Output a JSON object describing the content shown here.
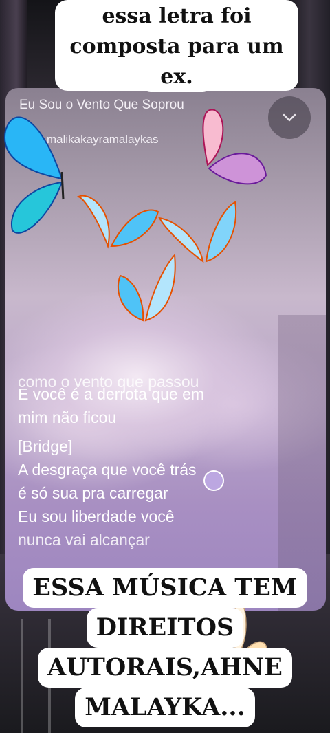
{
  "caption_top": {
    "line1": "essa letra foi",
    "line2": "composta para um",
    "line3": "ex."
  },
  "player": {
    "song_title": "Eu Sou o Vento Que Soprou",
    "artist": "malikakayramalaykas",
    "collapse_icon": "chevron-down-icon",
    "lyrics": {
      "cut_line": "como o vento que passou",
      "lines": [
        "E você é a derrota que em",
        "mim não ficou",
        "[Bridge]",
        "A desgraça que você trás",
        "é só sua pra carregar",
        "Eu sou liberdade você",
        "nunca vai alcançar"
      ]
    }
  },
  "caption_bottom": {
    "line1": "ESSA MÚSICA TEM",
    "line2": "DIREITOS",
    "line3": "AUTORAIS,AHNE",
    "line4": "MALAYKA..."
  },
  "colors": {
    "sky_top": "#8a8090",
    "sky_bottom": "#9d86c0",
    "butterfly_blue": "#29b6f6",
    "butterfly_pink": "#f48fb1"
  }
}
